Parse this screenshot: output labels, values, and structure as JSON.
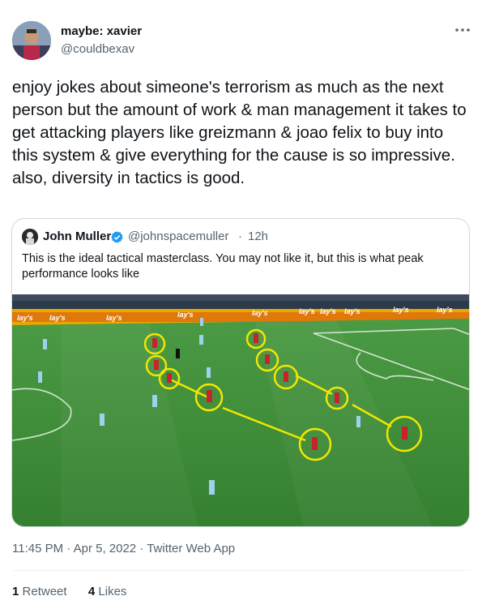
{
  "author": {
    "display_name": "maybe: xavier",
    "handle": "@couldbexav"
  },
  "more_icon": "more-horizontal-icon",
  "tweet_text": "enjoy jokes about simeone's terrorism as much as the next person but the amount of work & man management it takes to get attacking players like greizmann & joao felix to buy into this system & give everything for the cause is so impressive. also, diversity in tactics is good.",
  "quoted_tweet": {
    "display_name": "John Muller",
    "verified_icon": "verified-badge-icon",
    "handle": "@johnspacemuller",
    "separator": "·",
    "time": "12h",
    "text": "This is the ideal tactical masterclass. You may not like it, but this is what peak performance looks like",
    "ad_board_text": "lay's"
  },
  "meta": "11:45 PM · Apr 5, 2022 · Twitter Web App",
  "stats": {
    "retweets_count": "1",
    "retweets_label": "Retweet",
    "likes_count": "4",
    "likes_label": "Likes"
  },
  "colors": {
    "link_blue": "#1d9bf0",
    "highlight_yellow": "#f2e600",
    "pitch_green": "#3f8f3a",
    "secondary_text": "#536471"
  }
}
